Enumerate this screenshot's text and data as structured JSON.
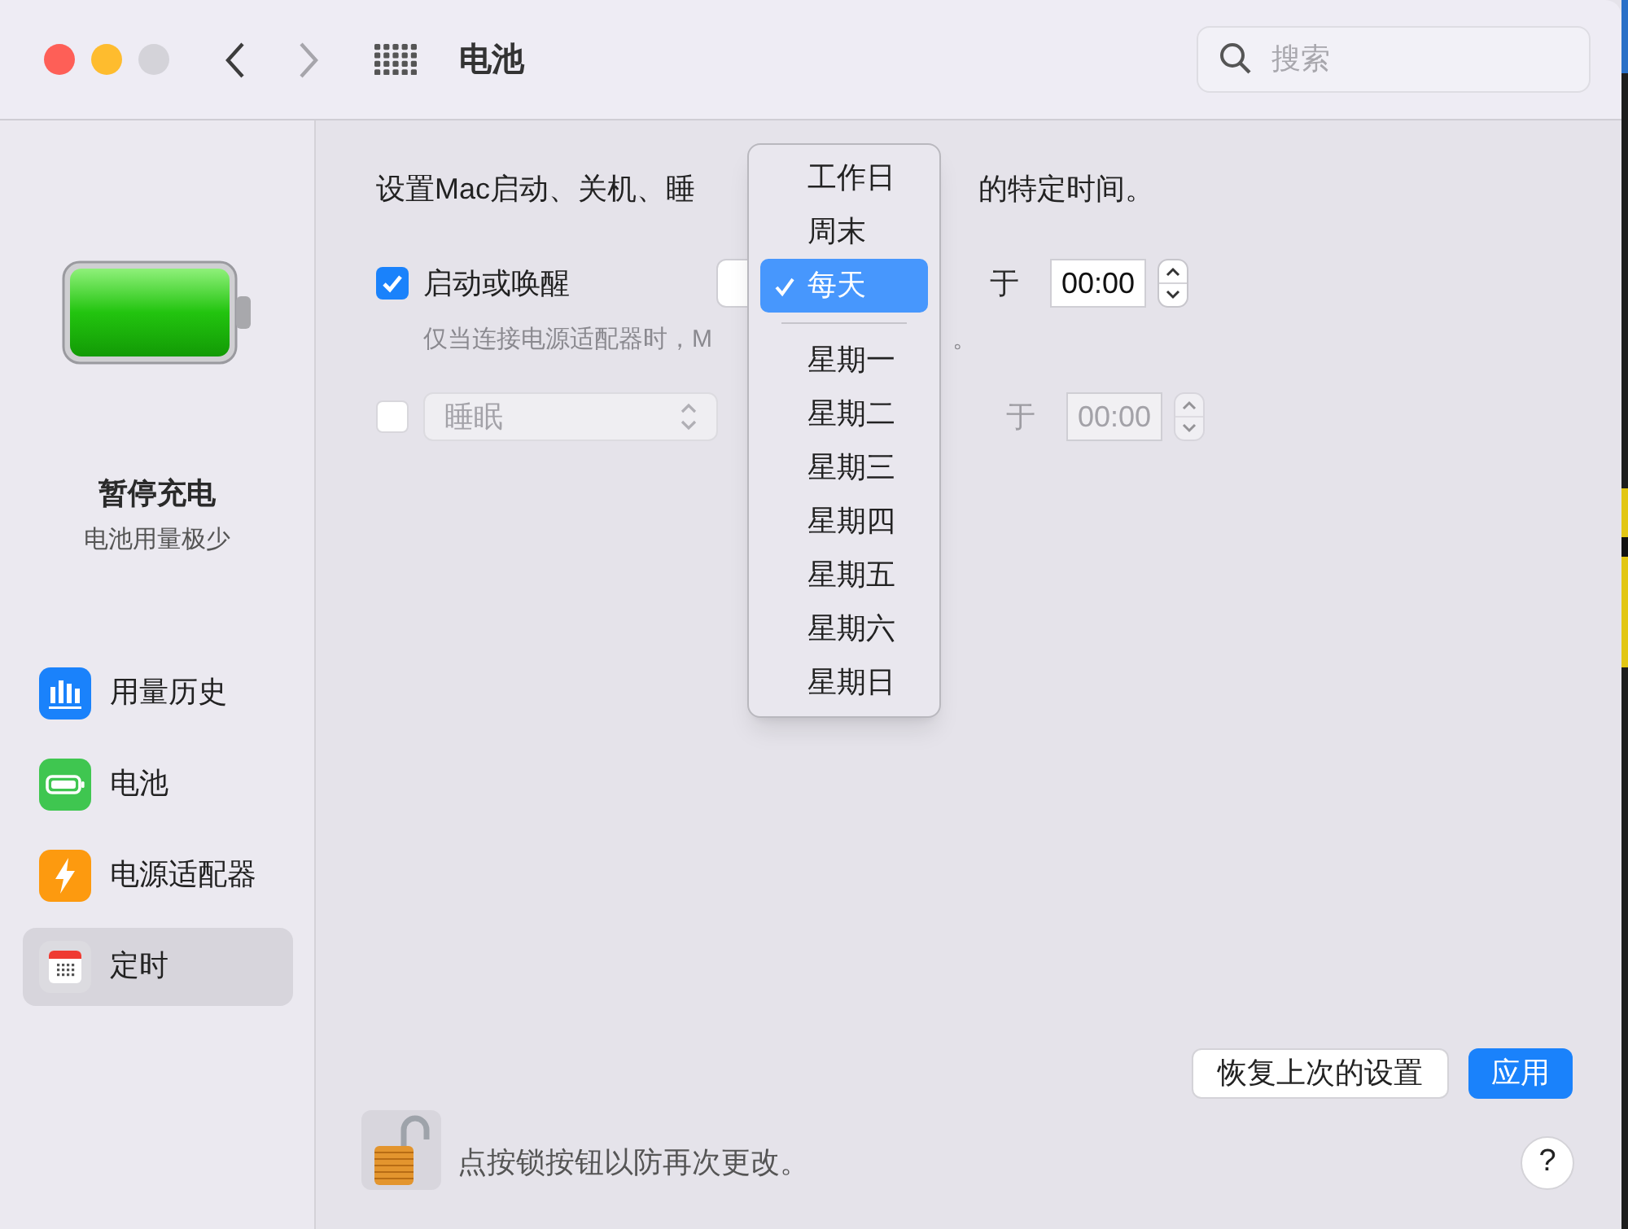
{
  "window": {
    "title": "电池"
  },
  "nav": [
    {
      "kind": "back",
      "disabled": false
    },
    {
      "kind": "forward",
      "disabled": true
    }
  ],
  "search": {
    "placeholder": "搜索"
  },
  "sidebar": {
    "status_title": "暂停充电",
    "status_subtitle": "电池用量极少",
    "items": [
      {
        "label": "用量历史",
        "kind": "chart",
        "selected": false
      },
      {
        "label": "电池",
        "kind": "battery",
        "selected": false
      },
      {
        "label": "电源适配器",
        "kind": "power",
        "selected": false
      },
      {
        "label": "定时",
        "kind": "calendar",
        "selected": true
      }
    ]
  },
  "schedule": {
    "intro_parts": [
      "设置Mac启动、关机、睡",
      "的特定时间。"
    ],
    "note_parts": [
      "仅当连接电源适配器时，M",
      "。"
    ],
    "rows": [
      {
        "kind": "label",
        "checked": true,
        "disabled": false,
        "label": "启动或唤醒",
        "at": "于",
        "time": "00:00"
      },
      {
        "kind": "popup",
        "checked": false,
        "disabled": true,
        "label": "睡眠",
        "at": "于",
        "time": "00:00"
      }
    ]
  },
  "menu": [
    {
      "kind": "item",
      "label": "工作日",
      "selected": false
    },
    {
      "kind": "item",
      "label": "周末",
      "selected": false
    },
    {
      "kind": "item",
      "label": "每天",
      "selected": true
    },
    {
      "kind": "separator"
    },
    {
      "kind": "item",
      "label": "星期一",
      "selected": false
    },
    {
      "kind": "item",
      "label": "星期二",
      "selected": false
    },
    {
      "kind": "item",
      "label": "星期三",
      "selected": false
    },
    {
      "kind": "item",
      "label": "星期四",
      "selected": false
    },
    {
      "kind": "item",
      "label": "星期五",
      "selected": false
    },
    {
      "kind": "item",
      "label": "星期六",
      "selected": false
    },
    {
      "kind": "item",
      "label": "星期日",
      "selected": false
    }
  ],
  "buttons": {
    "revert": "恢复上次的设置",
    "apply": "应用"
  },
  "lock_text": "点按锁按钮以防再次更改。",
  "help": "?"
}
